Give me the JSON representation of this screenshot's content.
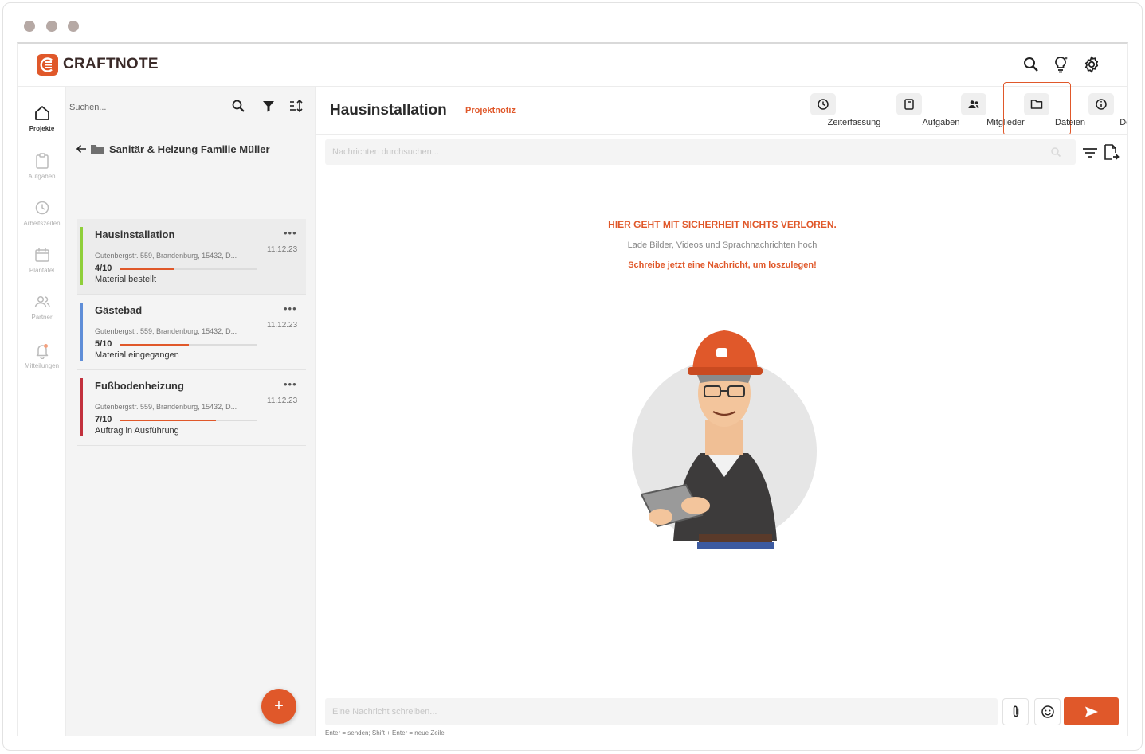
{
  "window": {
    "brand": "CRAFTNOTE"
  },
  "colors": {
    "accent": "#e0582a",
    "green": "#8fcf3a",
    "blue": "#5f8ed8",
    "red": "#c2313d"
  },
  "header_icons": [
    "search-icon",
    "lightbulb-icon",
    "gear-icon"
  ],
  "nav": {
    "items": [
      {
        "label": "Projekte",
        "icon": "home-icon",
        "active": true
      },
      {
        "label": "Aufgaben",
        "icon": "clipboard-icon",
        "active": false
      },
      {
        "label": "Arbeitszeiten",
        "icon": "clock-icon",
        "active": false
      },
      {
        "label": "Plantafel",
        "icon": "calendar-icon",
        "active": false
      },
      {
        "label": "Partner",
        "icon": "users-icon",
        "active": false
      },
      {
        "label": "Mitteilungen",
        "icon": "bell-icon",
        "active": false
      }
    ]
  },
  "list": {
    "search_placeholder": "Suchen...",
    "folder_title": "Sanitär & Heizung Familie Müller",
    "projects": [
      {
        "title": "Hausinstallation",
        "address": "Gutenbergstr. 559, Brandenburg, 15432, D...",
        "date": "11.12.23",
        "count": "4/10",
        "progress": 0.4,
        "status": "Material bestellt",
        "color": "#8fcf3a",
        "selected": true
      },
      {
        "title": "Gästebad",
        "address": "Gutenbergstr. 559, Brandenburg, 15432, D...",
        "date": "11.12.23",
        "count": "5/10",
        "progress": 0.5,
        "status": "Material eingegangen",
        "color": "#5f8ed8",
        "selected": false
      },
      {
        "title": "Fußbodenheizung",
        "address": "Gutenbergstr. 559, Brandenburg, 15432, D...",
        "date": "11.12.23",
        "count": "7/10",
        "progress": 0.7,
        "status": "Auftrag in Ausführung",
        "color": "#c2313d",
        "selected": false
      }
    ],
    "add_label": "+"
  },
  "main": {
    "title": "Hausinstallation",
    "subtitle": "Projektnotiz",
    "tabs": [
      {
        "label": "Zeiterfassung",
        "icon": "clock-icon"
      },
      {
        "label": "Aufgaben",
        "icon": "clipboard-icon"
      },
      {
        "label": "Mitglieder",
        "icon": "users-icon"
      },
      {
        "label": "Dateien",
        "icon": "folder-icon",
        "highlighted": true
      },
      {
        "label": "Details",
        "icon": "info-icon"
      }
    ],
    "message_search_placeholder": "Nachrichten durchsuchen...",
    "empty_state": {
      "headline": "HIER GEHT MIT SICHERHEIT NICHTS VERLOREN.",
      "subline": "Lade Bilder, Videos und Sprachnachrichten hoch",
      "cta": "Schreibe jetzt eine Nachricht, um loszulegen!"
    },
    "composer": {
      "placeholder": "Eine Nachricht schreiben...",
      "hint": "Enter = senden; Shift + Enter = neue Zeile"
    }
  }
}
